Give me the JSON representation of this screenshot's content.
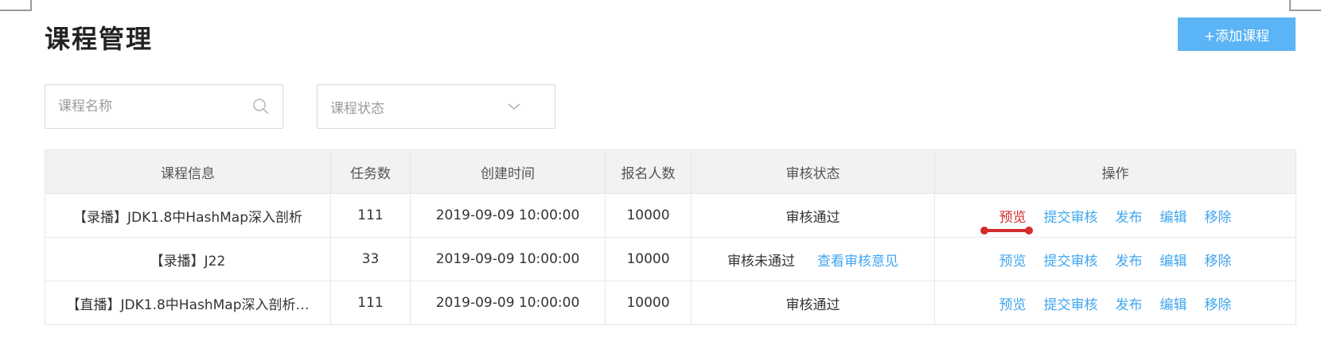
{
  "page": {
    "title": "课程管理"
  },
  "toolbar": {
    "add_label": "+添加课程"
  },
  "filters": {
    "name_placeholder": "课程名称",
    "status_placeholder": "课程状态",
    "search_icon": "search-icon",
    "dropdown_icon": "chevron-down-icon"
  },
  "table": {
    "headers": [
      "课程信息",
      "任务数",
      "创建时间",
      "报名人数",
      "审核状态",
      "操作"
    ],
    "rows": [
      {
        "info": "【录播】JDK1.8中HashMap深入剖析",
        "tasks": "111",
        "created": "2019-09-09 10:00:00",
        "enrolled": "10000",
        "status": "审核通过",
        "status_link": "",
        "ops": [
          "预览",
          "提交审核",
          "发布",
          "编辑",
          "移除"
        ]
      },
      {
        "info": "【录播】J22",
        "tasks": "33",
        "created": "2019-09-09 10:00:00",
        "enrolled": "10000",
        "status": "审核未通过",
        "status_link": "查看审核意见",
        "ops": [
          "预览",
          "提交审核",
          "发布",
          "编辑",
          "移除"
        ]
      },
      {
        "info": "【直播】JDK1.8中HashMap深入剖析…",
        "tasks": "111",
        "created": "2019-09-09 10:00:00",
        "enrolled": "10000",
        "status": "审核通过",
        "status_link": "",
        "ops": [
          "预览",
          "提交审核",
          "发布",
          "编辑",
          "移除"
        ]
      }
    ]
  },
  "colors": {
    "accent": "#41a6f0",
    "button": "#5ab4f5",
    "annotation": "#d62b2b",
    "first_row_preview": "#d62b2b"
  }
}
